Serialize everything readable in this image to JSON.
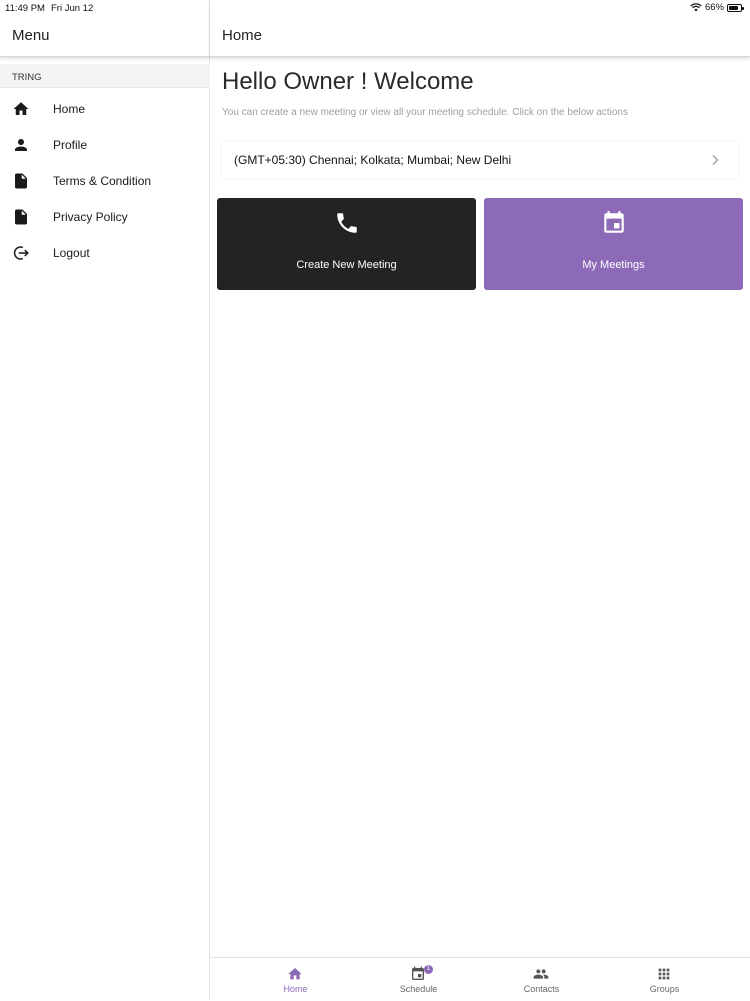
{
  "status_bar": {
    "time": "11:49 PM",
    "date": "Fri Jun 12",
    "battery": "66%",
    "battery_level": 0.66
  },
  "sidebar": {
    "title": "Menu",
    "section": "TRING",
    "items": [
      {
        "label": "Home",
        "icon": "home-icon"
      },
      {
        "label": "Profile",
        "icon": "person-icon"
      },
      {
        "label": "Terms & Condition",
        "icon": "document-icon"
      },
      {
        "label": "Privacy Policy",
        "icon": "document-icon"
      },
      {
        "label": "Logout",
        "icon": "logout-icon"
      }
    ]
  },
  "header": {
    "title": "Home"
  },
  "main": {
    "welcome": "Hello Owner ! Welcome",
    "subtitle": "You can create a new meeting or view all your meeting schedule. Click on the below actions",
    "timezone": "(GMT+05:30) Chennai; Kolkata; Mumbai; New Delhi",
    "actions": [
      {
        "label": "Create New Meeting",
        "icon": "phone-icon",
        "color": "#232323"
      },
      {
        "label": "My Meetings",
        "icon": "calendar-icon",
        "color": "#8d6ab8"
      }
    ]
  },
  "tabbar": {
    "accent": "#8d6ab8",
    "tabs": [
      {
        "label": "Home",
        "icon": "home-icon",
        "active": true
      },
      {
        "label": "Schedule",
        "icon": "calendar-icon",
        "badge": "1"
      },
      {
        "label": "Contacts",
        "icon": "people-icon"
      },
      {
        "label": "Groups",
        "icon": "grid-icon"
      }
    ]
  }
}
